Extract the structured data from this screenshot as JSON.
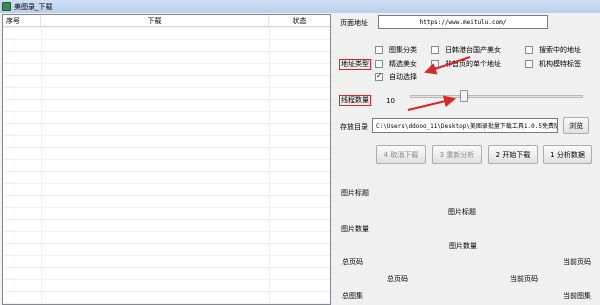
{
  "window": {
    "title": "美图录_下载"
  },
  "list": {
    "columns": [
      "序号",
      "下载",
      "状态"
    ]
  },
  "form": {
    "url_label": "页面地址",
    "url_value": "https://www.meitulu.com/",
    "type_label": "地址类型",
    "checkboxes": [
      {
        "label": "图集分类",
        "checked": false
      },
      {
        "label": "日韩港台国产美女",
        "checked": false
      },
      {
        "label": "搜索中的地址",
        "checked": false
      },
      {
        "label": "精选美女",
        "checked": false
      },
      {
        "label": "非首页的单个地址",
        "checked": false
      },
      {
        "label": "机构模特标签",
        "checked": false
      },
      {
        "label": "自动选择",
        "checked": true
      }
    ],
    "threads_label": "线程数量",
    "threads_value": "10",
    "save_label": "存放目录",
    "save_path": "C:\\Users\\ddooo_11\\Desktop\\美图录批量下载工具1.0.5免费版",
    "browse_button": "浏览"
  },
  "actions": [
    {
      "label": "4 取消下载",
      "enabled": false
    },
    {
      "label": "3 重新分析",
      "enabled": false
    },
    {
      "label": "2 开始下载",
      "enabled": true
    },
    {
      "label": "1 分析数据",
      "enabled": true
    }
  ],
  "info": {
    "image_title_label": "图片标题",
    "image_title_value": "图片标题",
    "image_count_label": "图片数量",
    "image_count_value": "图片数量",
    "total_pages_left": "总页码",
    "current_page_right": "当前页码",
    "total_pages_mid": "总页码",
    "current_page_mid": "当前页码",
    "album_left": "总图集",
    "album_right": "当前图集"
  },
  "colors": {
    "highlight": "#d9262b"
  }
}
